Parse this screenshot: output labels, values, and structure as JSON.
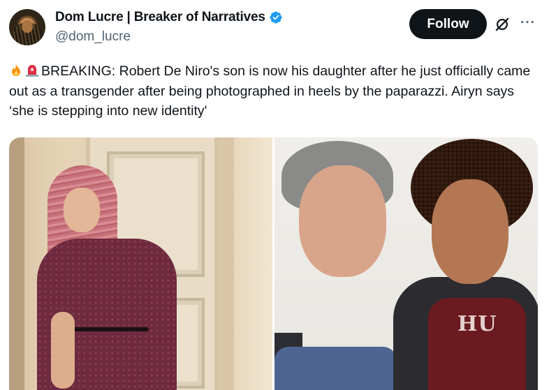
{
  "author": {
    "display_name": "Dom Lucre | Breaker of Narratives",
    "handle": "@dom_lucre",
    "verified": true,
    "verified_color": "#1d9bf0"
  },
  "actions": {
    "follow_label": "Follow",
    "grok_icon": "grok-icon",
    "more_label": "···"
  },
  "tweet": {
    "emojis": [
      "fire-emoji",
      "siren-emoji"
    ],
    "text": "BREAKING: Robert De Niro's son is now his daughter after he just officially came out as a transgender after being photographed in heels by the paparazzi. Airyn says ‘she is stepping into new identity'"
  },
  "media": {
    "count": 2,
    "photos": [
      {
        "shirt_text": ""
      },
      {
        "shirt_text": "HU"
      }
    ]
  },
  "colors": {
    "text_primary": "#0f1419",
    "text_secondary": "#536471",
    "follow_bg": "#0f1419"
  }
}
